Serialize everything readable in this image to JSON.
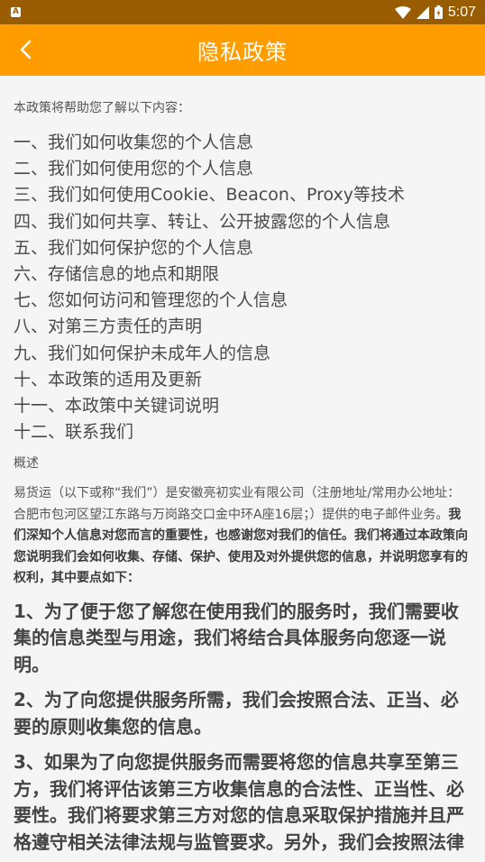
{
  "status_bar": {
    "time": "5:07",
    "app_badge": "A"
  },
  "header": {
    "title": "隐私政策"
  },
  "intro": "本政策将帮助您了解以下内容：",
  "toc": [
    "一、我们如何收集您的个人信息",
    "二、我们如何使用您的个人信息",
    "三、我们如何使用Cookie、Beacon、Proxy等技术",
    "四、我们如何共享、转让、公开披露您的个人信息",
    "五、我们如何保护您的个人信息",
    "六、存储信息的地点和期限",
    "七、您如何访问和管理您的个人信息",
    "八、对第三方责任的声明",
    "九、我们如何保护未成年人的信息",
    "十、本政策的适用及更新",
    "十一、本政策中关键词说明",
    "十二、联系我们"
  ],
  "overview": {
    "heading": "概述",
    "text_normal": "易货运（以下或称“我们”）是安徽亮初实业有限公司（注册地址/常用办公地址：合肥市包河区望江东路与万岗路交口金中环A座16层；）提供的电子邮件业务。",
    "text_bold": "我们深知个人信息对您而言的重要性，也感谢您对我们的信任。我们将通过本政策向您说明我们会如何收集、存储、保护、使用及对外提供您的信息，并说明您享有的权利，其中要点如下："
  },
  "points": [
    "1、为了便于您了解您在使用我们的服务时，我们需要收集的信息类型与用途，我们将结合具体服务向您逐一说明。",
    "2、为了向您提供服务所需，我们会按照合法、正当、必要的原则收集您的信息。",
    "3、如果为了向您提供服务而需要将您的信息共享至第三方，我们将评估该第三方收集信息的合法性、正当性、必要性。我们将要求第三方对您的信息采取保护措施并且严格遵守相关法律法规与监管要求。另外，我们会按照法律"
  ],
  "colors": {
    "status_bar": "#9a5c00",
    "app_bar": "#ff9c00",
    "background": "#f5f5f5"
  }
}
